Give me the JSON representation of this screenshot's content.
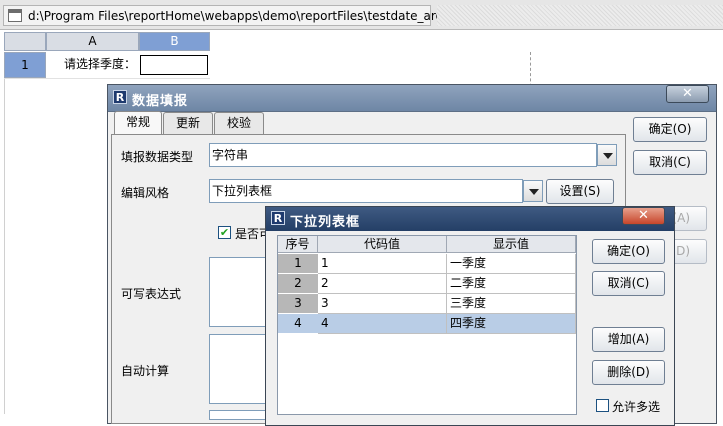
{
  "file_tab": {
    "path": "d:\\Program Files\\reportHome\\webapps\\demo\\reportFiles\\testdate_arg.raq"
  },
  "sheet": {
    "col_a": "A",
    "col_b": "B",
    "row_1": "1",
    "prompt_label": "请选择季度：",
    "prompt_value": ""
  },
  "fill_dialog": {
    "title": "数据填报",
    "close": "✕",
    "tabs": [
      "常规",
      "更新",
      "校验"
    ],
    "data_type_label": "填报数据类型",
    "data_type_value": "字符串",
    "edit_style_label": "编辑风格",
    "edit_style_value": "下拉列表框",
    "settings_button": "设置(S)",
    "checkbox_label": "是否可",
    "checkbox_checked": true,
    "writable_expr_label": "可写表达式",
    "auto_calc_label": "自动计算",
    "ok_button": "确定(O)",
    "cancel_button": "取消(C)",
    "hidden_btn1": "(A)",
    "hidden_btn2": "(D)"
  },
  "dropdown_dialog": {
    "title": "下拉列表框",
    "close": "✕",
    "columns": [
      "序号",
      "代码值",
      "显示值"
    ],
    "rows": [
      {
        "index": "1",
        "code": "1",
        "display": "一季度"
      },
      {
        "index": "2",
        "code": "2",
        "display": "二季度"
      },
      {
        "index": "3",
        "code": "3",
        "display": "三季度"
      },
      {
        "index": "4",
        "code": "4",
        "display": "四季度"
      }
    ],
    "selected_row": 4,
    "ok_button": "确定(O)",
    "cancel_button": "取消(C)",
    "add_button": "增加(A)",
    "delete_button": "删除(D)",
    "multi_select_label": "允许多选",
    "multi_select_checked": false
  },
  "colors": {
    "selected_header": "#7f9fd4",
    "dialog_title": "#6e86a5",
    "dropdown_title": "#243f66",
    "selected_row": "#b9cde6"
  }
}
